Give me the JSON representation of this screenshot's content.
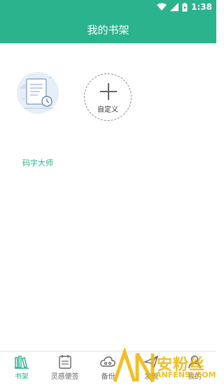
{
  "status_bar": {
    "time": "1:38"
  },
  "app_bar": {
    "title": "我的书架"
  },
  "shelf": {
    "books": [
      {
        "title": "码字大师"
      }
    ],
    "add_card": {
      "label": "自定义"
    }
  },
  "nav": {
    "items": [
      {
        "label": "书架",
        "icon": "bookshelf-icon",
        "active": true
      },
      {
        "label": "灵感便签",
        "icon": "notepad-icon",
        "active": false
      },
      {
        "label": "备份",
        "icon": "cloud-icon",
        "active": false
      },
      {
        "label": "发现",
        "icon": "paper-plane-icon",
        "active": false
      },
      {
        "label": "我的",
        "icon": "user-icon",
        "active": false
      }
    ]
  },
  "watermark": {
    "text": "安粉丝",
    "subtext": "ANFENSI.COM"
  },
  "colors": {
    "accent": "#2bb38e",
    "watermark": "#f0b400"
  }
}
